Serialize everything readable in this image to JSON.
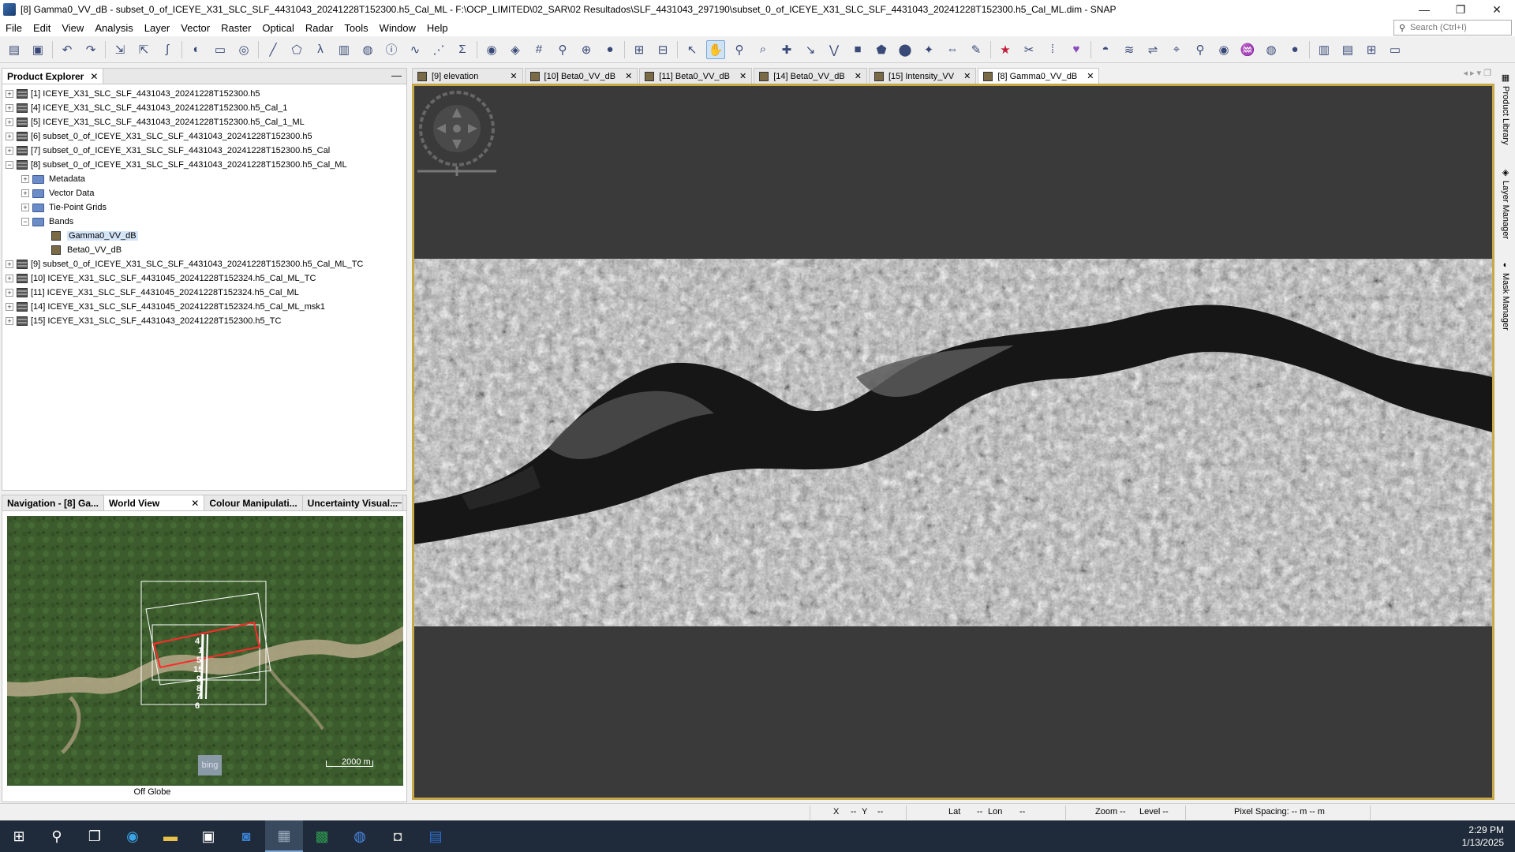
{
  "window": {
    "title": "[8] Gamma0_VV_dB - subset_0_of_ICEYE_X31_SLC_SLF_4431043_20241228T152300.h5_Cal_ML - F:\\OCP_LIMITED\\02_SAR\\02 Resultados\\SLF_4431043_297190\\subset_0_of_ICEYE_X31_SLC_SLF_4431043_20241228T152300.h5_Cal_ML.dim - SNAP",
    "minimize": "—",
    "restore": "❐",
    "close": "✕"
  },
  "menu": [
    "File",
    "Edit",
    "View",
    "Analysis",
    "Layer",
    "Vector",
    "Raster",
    "Optical",
    "Radar",
    "Tools",
    "Window",
    "Help"
  ],
  "search": {
    "placeholder": "Search (Ctrl+I)"
  },
  "toolbar_icons": [
    "open-product-icon",
    "save-icon",
    "undo-icon",
    "redo-icon",
    "import-icon",
    "export-icon",
    "band-maths-icon",
    "rgb-icon",
    "mask-icon",
    "zoom-tool-icon",
    "draw-line-icon",
    "draw-polygon-icon",
    "spectrum-icon",
    "histogram-icon",
    "statistics-icon",
    "information-icon",
    "profile-icon",
    "scatter-icon",
    "sum-icon",
    "world-map-icon",
    "layer-icon",
    "graticule-icon",
    "pin-icon",
    "gcp-icon",
    "mask-manager-icon",
    "tile-icon",
    "sync-cursor-icon"
  ],
  "product_explorer": {
    "tab": "Product Explorer",
    "items": [
      {
        "label": "[1] ICEYE_X31_SLC_SLF_4431043_20241228T152300.h5",
        "expander": "+"
      },
      {
        "label": "[4] ICEYE_X31_SLC_SLF_4431043_20241228T152300.h5_Cal_1",
        "expander": "+"
      },
      {
        "label": "[5] ICEYE_X31_SLC_SLF_4431043_20241228T152300.h5_Cal_1_ML",
        "expander": "+"
      },
      {
        "label": "[6] subset_0_of_ICEYE_X31_SLC_SLF_4431043_20241228T152300.h5",
        "expander": "+"
      },
      {
        "label": "[7] subset_0_of_ICEYE_X31_SLC_SLF_4431043_20241228T152300.h5_Cal",
        "expander": "+"
      },
      {
        "label": "[8] subset_0_of_ICEYE_X31_SLC_SLF_4431043_20241228T152300.h5_Cal_ML",
        "expander": "−"
      }
    ],
    "children": [
      {
        "label": "Metadata",
        "expander": "+"
      },
      {
        "label": "Vector Data",
        "expander": "+"
      },
      {
        "label": "Tie-Point Grids",
        "expander": "+"
      },
      {
        "label": "Bands",
        "expander": "−"
      }
    ],
    "bands": [
      "Gamma0_VV_dB",
      "Beta0_VV_dB"
    ],
    "items_after": [
      {
        "label": "[9] subset_0_of_ICEYE_X31_SLC_SLF_4431043_20241228T152300.h5_Cal_ML_TC",
        "expander": "+"
      },
      {
        "label": "[10] ICEYE_X31_SLC_SLF_4431045_20241228T152324.h5_Cal_ML_TC",
        "expander": "+"
      },
      {
        "label": "[11] ICEYE_X31_SLC_SLF_4431045_20241228T152324.h5_Cal_ML",
        "expander": "+"
      },
      {
        "label": "[14] ICEYE_X31_SLC_SLF_4431045_20241228T152324.h5_Cal_ML_msk1",
        "expander": "+"
      },
      {
        "label": "[15] ICEYE_X31_SLC_SLF_4431043_20241228T152300.h5_TC",
        "expander": "+"
      }
    ]
  },
  "nav_panel": {
    "tabs": [
      "Navigation - [8] Ga...",
      "World View",
      "Colour Manipulati...",
      "Uncertainty Visual..."
    ],
    "close": "✕",
    "minimize": "—",
    "map_labels": [
      "4",
      "1",
      "5",
      "15",
      "9",
      "8",
      "7",
      "6"
    ],
    "scale": "2000 m",
    "provider": "bing",
    "footer": "Off Globe"
  },
  "doc_tabs": [
    {
      "label": "[9] elevation"
    },
    {
      "label": "[10] Beta0_VV_dB"
    },
    {
      "label": "[11] Beta0_VV_dB"
    },
    {
      "label": "[14] Beta0_VV_dB"
    },
    {
      "label": "[15] Intensity_VV"
    },
    {
      "label": "[8] Gamma0_VV_dB"
    }
  ],
  "doc_nav": "◂ ▸ ▾ ❐",
  "right_sidebar": [
    "Product Library",
    "Layer Manager",
    "Mask Manager"
  ],
  "status": {
    "x": "X",
    "x_val": "--",
    "y": "Y",
    "y_val": "--",
    "lat": "Lat",
    "lat_val": "--",
    "lon": "Lon",
    "lon_val": "--",
    "zoom": "Zoom --",
    "level": "Level --",
    "pixel_spacing": "Pixel Spacing: -- m -- m"
  },
  "taskbar": {
    "time": "2:29 PM",
    "date": "1/13/2025"
  },
  "colors": {
    "accent_frame": "#c8a94a",
    "view_bg": "#3a3a3a",
    "taskbar": "#1f2b3a"
  }
}
